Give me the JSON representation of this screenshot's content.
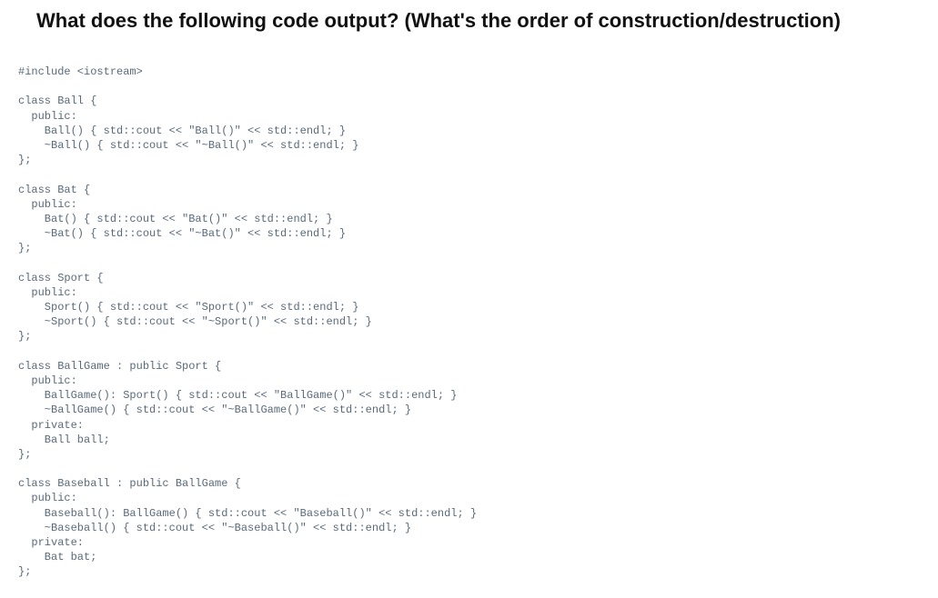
{
  "heading": "What does the following code output? (What's the order of construction/destruction)",
  "code": "#include <iostream>\n\nclass Ball {\n  public:\n    Ball() { std::cout << \"Ball()\" << std::endl; }\n    ~Ball() { std::cout << \"~Ball()\" << std::endl; }\n};\n\nclass Bat {\n  public:\n    Bat() { std::cout << \"Bat()\" << std::endl; }\n    ~Bat() { std::cout << \"~Bat()\" << std::endl; }\n};\n\nclass Sport {\n  public:\n    Sport() { std::cout << \"Sport()\" << std::endl; }\n    ~Sport() { std::cout << \"~Sport()\" << std::endl; }\n};\n\nclass BallGame : public Sport {\n  public:\n    BallGame(): Sport() { std::cout << \"BallGame()\" << std::endl; }\n    ~BallGame() { std::cout << \"~BallGame()\" << std::endl; }\n  private:\n    Ball ball;\n};\n\nclass Baseball : public BallGame {\n  public:\n    Baseball(): BallGame() { std::cout << \"Baseball()\" << std::endl; }\n    ~Baseball() { std::cout << \"~Baseball()\" << std::endl; }\n  private:\n    Bat bat;\n};"
}
